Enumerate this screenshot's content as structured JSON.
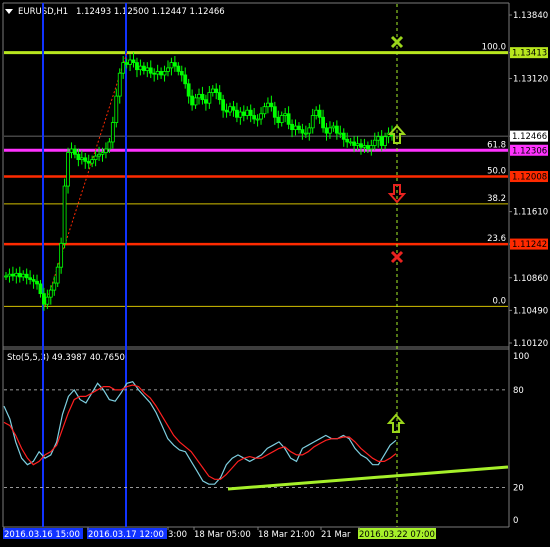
{
  "header": {
    "symbol": "EURUSD,H1",
    "ohlc": "1.12493 1.12500 1.12447 1.12466"
  },
  "colors": {
    "background": "#000000",
    "bull_candle": "#00ff00",
    "bear_candle": "#00ff00",
    "fib_100": "#b8e61e",
    "fib_61_8": "#ff33ff",
    "fib_50": "#ff2a00",
    "fib_23_6": "#ff2a00",
    "fib_thin": "#d4c000",
    "vline": "#1133ff",
    "stoch_main": "#7ecfe0",
    "stoch_signal": "#ff2020",
    "trendline": "#a6f02a",
    "arrow_up": "#9bd61b",
    "arrow_down": "#e8231f",
    "cross_green": "#9bd61b",
    "cross_red": "#e8231f"
  },
  "chart_data": [
    {
      "type": "candlestick",
      "title": "EURUSD,H1",
      "ylim": [
        1.1012,
        1.1384
      ],
      "y_ticks": [
        "1.13840",
        "1.13413",
        "1.13120",
        "1.12466",
        "1.11610",
        "1.11242",
        "1.10860",
        "1.10490",
        "1.10120"
      ],
      "price_marker": {
        "value": 1.12466,
        "label": "1.12466"
      },
      "fib_levels": [
        {
          "level": "100.0",
          "price": 1.13413,
          "label": "1.13413",
          "style": "thick"
        },
        {
          "level": "61.8",
          "price": 1.12306,
          "label": "1.12306",
          "style": "thick"
        },
        {
          "level": "50.0",
          "price": 1.12008,
          "label": "1.12008",
          "style": "thick"
        },
        {
          "level": "38.2",
          "price": 1.11698,
          "label": "",
          "style": "thin"
        },
        {
          "level": "23.6",
          "price": 1.11242,
          "label": "1.11242",
          "style": "thick"
        },
        {
          "level": "0.0",
          "price": 1.10536,
          "label": "",
          "style": "thin"
        }
      ],
      "close_path": [
        1.1088,
        1.109,
        1.1088,
        1.1091,
        1.1087,
        1.109,
        1.1086,
        1.1084,
        1.1082,
        1.1079,
        1.1068,
        1.1056,
        1.1064,
        1.1072,
        1.108,
        1.1098,
        1.1125,
        1.119,
        1.1228,
        1.1232,
        1.1226,
        1.122,
        1.1222,
        1.1218,
        1.1216,
        1.122,
        1.1224,
        1.1226,
        1.1228,
        1.1232,
        1.124,
        1.1262,
        1.1292,
        1.1318,
        1.133,
        1.1328,
        1.1333,
        1.133,
        1.1322,
        1.1326,
        1.1321,
        1.1324,
        1.1318,
        1.1317,
        1.132,
        1.1316,
        1.132,
        1.1324,
        1.133,
        1.1326,
        1.132,
        1.1316,
        1.1306,
        1.1292,
        1.1282,
        1.129,
        1.1294,
        1.1288,
        1.1284,
        1.1296,
        1.13,
        1.1296,
        1.1288,
        1.1276,
        1.1274,
        1.128,
        1.1276,
        1.1268,
        1.1274,
        1.127,
        1.1276,
        1.127,
        1.1266,
        1.1266,
        1.1272,
        1.128,
        1.1284,
        1.128,
        1.1268,
        1.1262,
        1.127,
        1.1272,
        1.126,
        1.1254,
        1.1258,
        1.1254,
        1.125,
        1.125,
        1.1256,
        1.127,
        1.1276,
        1.1268,
        1.1256,
        1.125,
        1.1256,
        1.1258,
        1.125,
        1.125,
        1.1243,
        1.124,
        1.124,
        1.1236,
        1.1238,
        1.1234,
        1.1236,
        1.1232,
        1.1236,
        1.1242,
        1.1246,
        1.1236,
        1.1246,
        1.125,
        1.1247
      ],
      "vertical_lines": [
        "2016.03.16 15:00",
        "2016.03.17 12:00"
      ],
      "cursor_line": "2016.03.22 07:00",
      "trend_dashed": "from 0.0 low to 100.0 high",
      "markers": [
        {
          "type": "cross",
          "color": "green",
          "near": "100.0"
        },
        {
          "type": "up-arrow",
          "color": "green",
          "near": "61.8"
        },
        {
          "type": "down-arrow",
          "color": "red",
          "near": "50.0"
        },
        {
          "type": "cross",
          "color": "red",
          "near": "23.6"
        }
      ]
    },
    {
      "type": "line",
      "title": "Sto(5,5,3) 49.3987 40.7650",
      "ylim": [
        0,
        100
      ],
      "y_ticks": [
        "100",
        "80",
        "20",
        "0"
      ],
      "levels": [
        80,
        20
      ],
      "series": [
        {
          "name": "main",
          "values": [
            70,
            62,
            48,
            38,
            34,
            36,
            42,
            38,
            40,
            48,
            65,
            76,
            80,
            74,
            72,
            78,
            84,
            80,
            74,
            73,
            78,
            84,
            85,
            80,
            76,
            72,
            66,
            58,
            50,
            46,
            43,
            42,
            36,
            30,
            24,
            22,
            22,
            26,
            34,
            38,
            40,
            38,
            36,
            38,
            40,
            44,
            46,
            48,
            44,
            38,
            36,
            44,
            46,
            48,
            50,
            52,
            50,
            50,
            52,
            50,
            44,
            40,
            38,
            34,
            34,
            40,
            46,
            49
          ]
        },
        {
          "name": "signal",
          "values": [
            60,
            58,
            52,
            44,
            38,
            34,
            36,
            40,
            42,
            46,
            56,
            66,
            74,
            76,
            76,
            78,
            80,
            82,
            82,
            80,
            80,
            82,
            83,
            82,
            78,
            75,
            70,
            64,
            58,
            52,
            48,
            45,
            42,
            37,
            32,
            27,
            25,
            25,
            28,
            32,
            36,
            38,
            39,
            38,
            38,
            40,
            42,
            44,
            45,
            42,
            40,
            40,
            42,
            45,
            47,
            49,
            50,
            50,
            51,
            51,
            48,
            44,
            41,
            38,
            36,
            36,
            38,
            40.8
          ]
        }
      ],
      "trendline": "rising support line below lows",
      "marker": {
        "type": "up-arrow",
        "color": "green"
      }
    }
  ],
  "x_axis": {
    "labels": [
      "2016.03.16 15:00",
      "2016.03.17 12:00",
      "3:00",
      "18 Mar 05:00",
      "18 Mar 21:00",
      "21 Mar",
      "2016.03.22 07:00"
    ]
  }
}
